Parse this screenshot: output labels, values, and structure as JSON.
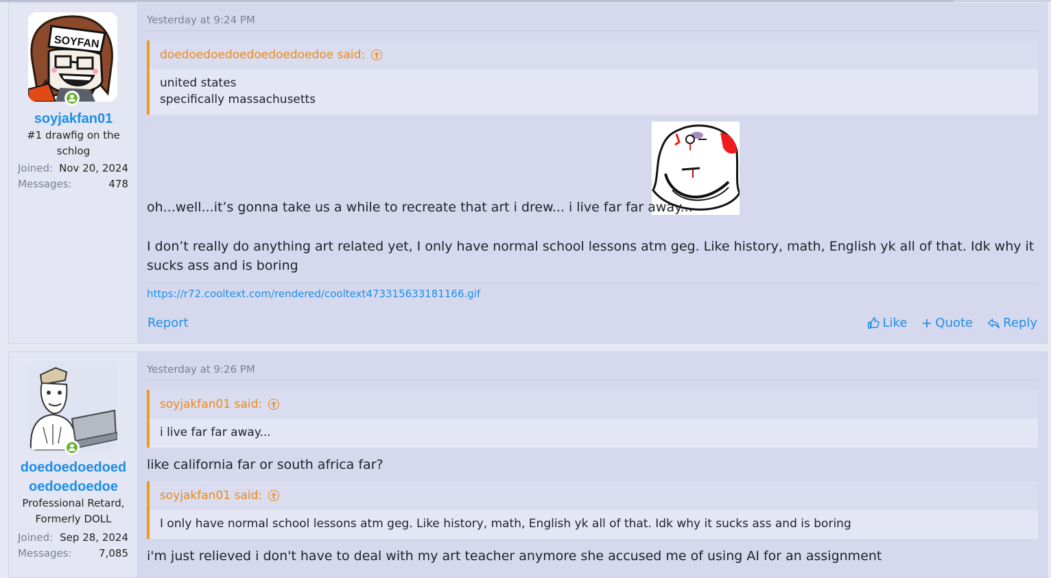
{
  "posts": [
    {
      "user": {
        "name": "soyjakfan01",
        "title": "#1 drawfig on the schlog",
        "joined_label": "Joined:",
        "joined_value": "Nov 20, 2024",
        "messages_label": "Messages:",
        "messages_value": "478",
        "avatar_text": "SOYFAN"
      },
      "date": "Yesterday at 9:24 PM",
      "quote": {
        "author": "doedoedoedoedoedoedoedoe said:",
        "lines": [
          "united states",
          "specifically massachusetts"
        ]
      },
      "text1": "oh...well...it’s gonna take us a while to recreate that art i drew... i live far far away...",
      "text2": "I don’t really do anything art related yet, I only have normal school lessons atm geg. Like history, math, English yk all of that. Idk why it sucks ass and is boring",
      "link": "https://r72.cooltext.com/rendered/cooltext473315633181166.gif",
      "report": "Report",
      "like": "Like",
      "quote_btn": "Quote",
      "reply": "Reply"
    },
    {
      "user": {
        "name_line1": "doedoedoedoed",
        "name_line2": "oedoedoedoe",
        "title_line1": "Professional Retard,",
        "title_line2": "Formerly DOLL",
        "joined_label": "Joined:",
        "joined_value": "Sep 28, 2024",
        "messages_label": "Messages:",
        "messages_value": "7,085"
      },
      "date": "Yesterday at 9:26 PM",
      "quote1": {
        "author": "soyjakfan01 said:",
        "body": "i live far far away..."
      },
      "text1": "like california far or south africa far?",
      "quote2": {
        "author": "soyjakfan01 said:",
        "body": "I only have normal school lessons atm geg. Like history, math, English yk all of that. Idk why it sucks ass and is boring"
      },
      "text2": "i'm just relieved i don't have to deal with my art teacher anymore she accused me of using AI for an assignment"
    }
  ],
  "colors": {
    "accent": "#1d8ee6",
    "quote_accent": "#ea8a17",
    "online": "#6cb333"
  },
  "icons": [
    "online-status-icon",
    "quote-jump-icon",
    "like-icon",
    "quote-add-icon",
    "reply-icon"
  ]
}
